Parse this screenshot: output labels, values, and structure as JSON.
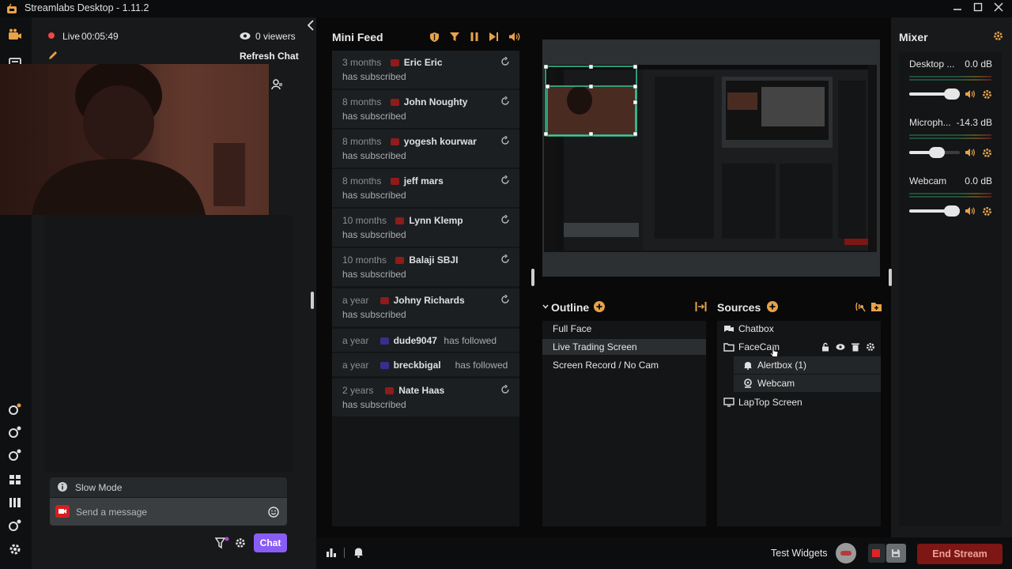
{
  "app": {
    "title": "Streamlabs Desktop - 1.11.2"
  },
  "chat": {
    "live_label": "Live",
    "live_time": "00:05:49",
    "viewers": "0 viewers",
    "refresh": "Refresh Chat",
    "slow_mode": "Slow Mode",
    "message_placeholder": "Send a message",
    "chat_button": "Chat"
  },
  "minifeed": {
    "title": "Mini Feed",
    "items": [
      {
        "time": "3 months",
        "name": "Eric Eric",
        "action": "has subscribed",
        "platform": "youtube"
      },
      {
        "time": "8 months",
        "name": "John Noughty",
        "action": "has subscribed",
        "platform": "youtube"
      },
      {
        "time": "8 months",
        "name": "yogesh kourwar",
        "action": "has subscribed",
        "platform": "youtube"
      },
      {
        "time": "8 months",
        "name": "jeff mars",
        "action": "has subscribed",
        "platform": "youtube"
      },
      {
        "time": "10 months",
        "name": "Lynn Klemp",
        "action": "has subscribed",
        "platform": "youtube"
      },
      {
        "time": "10 months",
        "name": "Balaji SBJI",
        "action": "has subscribed",
        "platform": "youtube"
      },
      {
        "time": "a year",
        "name": "Johny Richards",
        "action": "has subscribed",
        "platform": "youtube"
      },
      {
        "time": "a year",
        "name": "dude9047",
        "action": "has followed",
        "platform": "twitch"
      },
      {
        "time": "a year",
        "name": "breckbigal",
        "action": "has followed",
        "platform": "twitch"
      },
      {
        "time": "2 years",
        "name": "Nate Haas",
        "action": "has subscribed",
        "platform": "youtube"
      }
    ]
  },
  "outline": {
    "title": "Outline",
    "scenes": [
      "Full Face",
      "Live Trading Screen",
      "Screen Record / No Cam"
    ],
    "active": "Live Trading Screen"
  },
  "sources": {
    "title": "Sources",
    "items": [
      {
        "name": "Chatbox",
        "icon": "chat-icon"
      },
      {
        "name": "FaceCam",
        "icon": "folder-icon"
      },
      {
        "name": "Alertbox (1)",
        "icon": "bell-icon"
      },
      {
        "name": "Webcam",
        "icon": "webcam-icon"
      },
      {
        "name": "LapTop Screen",
        "icon": "monitor-icon"
      }
    ]
  },
  "mixer": {
    "title": "Mixer",
    "channels": [
      {
        "name": "Desktop ...",
        "db": "0.0 dB",
        "level": 0.85
      },
      {
        "name": "Microph...",
        "db": "-14.3 dB",
        "level": 0.55
      },
      {
        "name": "Webcam",
        "db": "0.0 dB",
        "level": 0.85
      }
    ]
  },
  "footer": {
    "test_widgets": "Test Widgets",
    "end_stream": "End Stream"
  },
  "colors": {
    "accent_purple": "#8a5cf6",
    "end_stream_bg": "#7c1714",
    "live_red": "#f04747",
    "youtube_red": "#8f1b1b",
    "twitch_purple": "#3b2d8f",
    "selection_green": "#38d39f"
  }
}
